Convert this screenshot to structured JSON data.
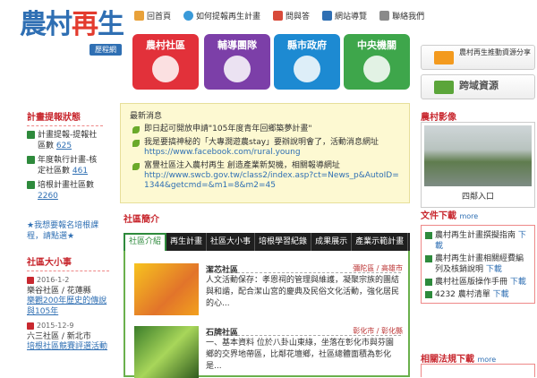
{
  "header": {
    "logo": {
      "part1": "農村",
      "part2": "再",
      "part3": "生",
      "version": "歷程網"
    },
    "nav": [
      {
        "label": "回首頁",
        "icon": "home-icon",
        "color": "#e8a13a"
      },
      {
        "label": "如何提報再生計畫",
        "icon": "guide-icon",
        "color": "#3a9ad9"
      },
      {
        "label": "問與答",
        "icon": "qa-icon",
        "color": "#d84a3a"
      },
      {
        "label": "網站導覽",
        "icon": "sitemap-icon",
        "color": "#2f6fb3"
      },
      {
        "label": "聯絡我們",
        "icon": "mail-icon",
        "color": "#8a8a8a"
      }
    ],
    "big_buttons": [
      "農村社區",
      "輔導團隊",
      "縣市政府",
      "中央機關"
    ],
    "side_buttons": [
      {
        "label": "農村再生推動資源分享"
      },
      {
        "label": "跨域資源"
      }
    ]
  },
  "plan": {
    "title": "計畫提報狀態",
    "rows": [
      {
        "text": "計畫提報-提報社區數",
        "value": "625"
      },
      {
        "text": "年度執行計畫-核定社區數",
        "value": "461"
      },
      {
        "text": "培根計畫社區數",
        "value": "2260"
      }
    ]
  },
  "ask": "★我想要報名培根課程，請點選★",
  "events": {
    "title": "社區大小事",
    "items": [
      {
        "date": "2016-1-2",
        "place": "樂谷社區 / 花蓮縣",
        "link": "樂觀200年歷史的傳說與105年"
      },
      {
        "date": "2015-12-9",
        "place": "六三社區 / 新北市",
        "link": "培根社區競賽評選活動"
      }
    ]
  },
  "news": {
    "title": "最新消息",
    "items": [
      {
        "text": "即日起可開放申請\"105年度青年回鄉築夢計畫\"",
        "url": ""
      },
      {
        "text": "我是要搞神秘的「大專澗遊農stay」要辦說明會了，活動消息網址",
        "url": "https://www.facebook.com/rural.young"
      },
      {
        "text": "富豐社區注入農村再生 創造產業新契機，相關報導網址",
        "url": "http://www.swcb.gov.tw/class2/index.asp?ct=News_p&AutoID=1344&getcmd=&m1=8&m2=45"
      }
    ]
  },
  "intro": {
    "title": "社區簡介",
    "tabs": [
      "社區介紹",
      "再生計畫",
      "社區大小事",
      "培根學習紀錄",
      "成果展示",
      "產業示範計畫"
    ],
    "cards": [
      {
        "name": "潔芯社區",
        "location": "彌陀區 / 高雄市",
        "desc": "人文活動保存：孝恩祠的管理與維護，凝聚宗族的團結與和諧，配合潔山宮的慶典及民俗文化活動，強化居民的心..."
      },
      {
        "name": "石牌社區",
        "location": "彰化市 / 彰化縣",
        "desc": "一、基本資料 位於八卦山東綠，坐落在彰化市與芬園鄉的交界地帶區，比鄰花壇鄉，社區總體面積為彰化是..."
      }
    ]
  },
  "right": {
    "photo_title": "農村影像",
    "photo_caption": "四鄰入口",
    "download": {
      "title": "文件下載",
      "more": "more",
      "items": [
        {
          "text": "農村再生計畫撰擬指南",
          "dl": "下載"
        },
        {
          "text": "農村再生計畫相關經費編列及核銷說明",
          "dl": "下載"
        },
        {
          "text": "農村社區版操作手冊",
          "dl": "下載"
        },
        {
          "text": "4232 農村清單",
          "dl": "下載"
        }
      ]
    },
    "regulations": {
      "title": "相關法規下載",
      "more": "more"
    }
  }
}
